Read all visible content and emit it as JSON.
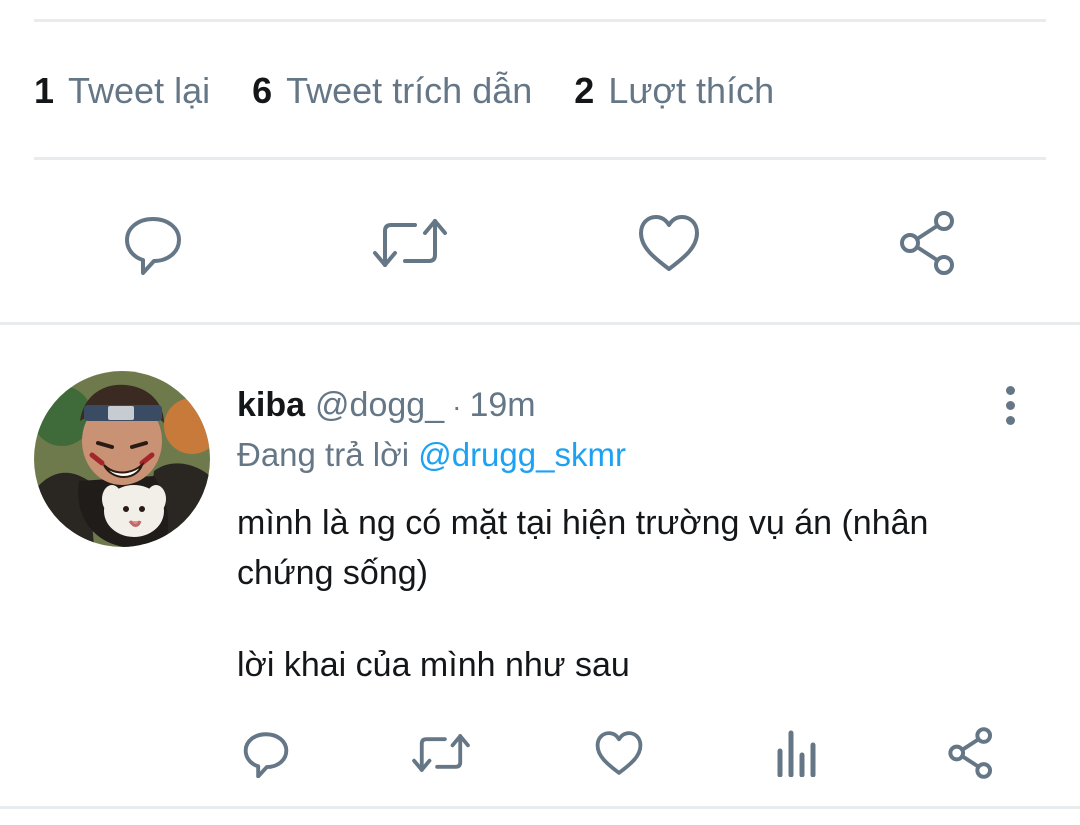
{
  "stats": [
    {
      "count": "1",
      "label": "Tweet lại"
    },
    {
      "count": "6",
      "label": "Tweet trích dẫn"
    },
    {
      "count": "2",
      "label": "Lượt thích"
    }
  ],
  "main_actions": [
    "reply-icon",
    "retweet-icon",
    "like-icon",
    "share-icon"
  ],
  "reply_tweet": {
    "author_name": "kiba",
    "author_handle": "@dogg_",
    "separator": "·",
    "timestamp": "19m",
    "replying_to_label": "Đang trả lời",
    "replying_to_handle": "@drugg_skmr",
    "body": [
      "mình là ng có mặt tại hiện trường vụ án (nhân chứng sống)",
      "lời khai của mình như sau"
    ],
    "actions": [
      "reply-icon",
      "retweet-icon",
      "like-icon",
      "analytics-icon",
      "share-icon"
    ]
  },
  "colors": {
    "text_primary": "#14171a",
    "text_secondary": "#657786",
    "link": "#1da1f2",
    "divider": "#e8ecef"
  }
}
